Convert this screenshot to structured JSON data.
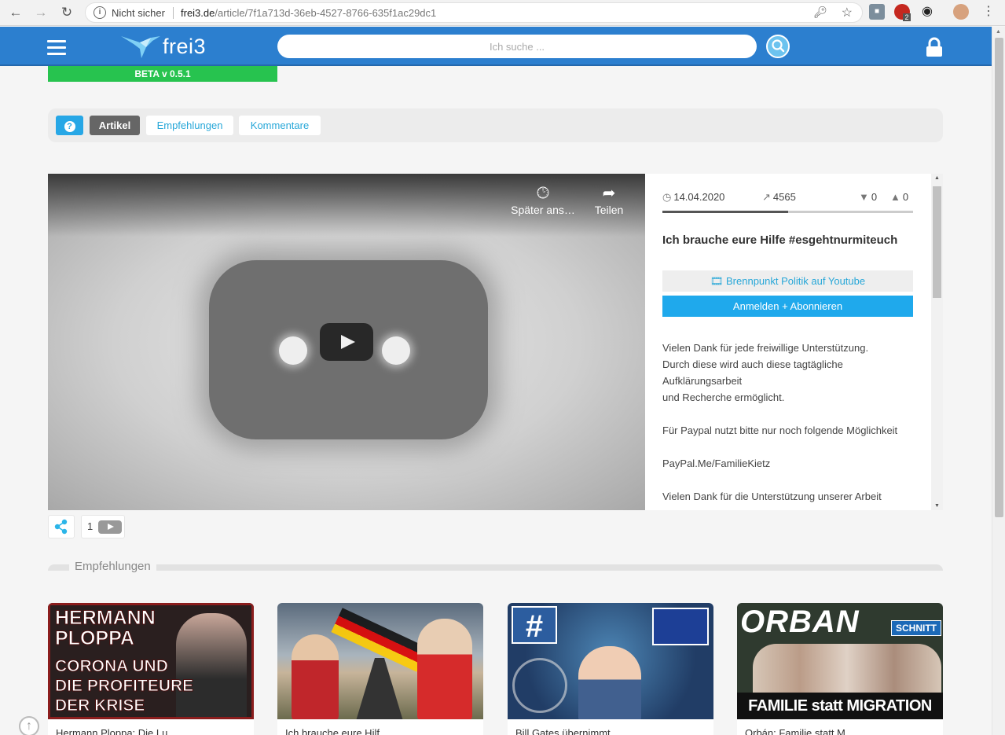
{
  "browser": {
    "security_label": "Nicht sicher",
    "url_domain": "frei3.de",
    "url_path": "/article/7f1a713d-36eb-4527-8766-635f1ac29dc1",
    "ext_badge": "2"
  },
  "header": {
    "logo_text": "frei3",
    "search_placeholder": "Ich suche ...",
    "beta_label": "BETA v 0.5.1"
  },
  "tabs": {
    "help_glyph": "?",
    "artikel": "Artikel",
    "empfehlungen": "Empfehlungen",
    "kommentare": "Kommentare"
  },
  "video": {
    "watch_later": "Später ans…",
    "share": "Teilen"
  },
  "article": {
    "date": "14.04.2020",
    "views": "4565",
    "dislikes": "0",
    "likes": "0",
    "title": "Ich brauche eure Hilfe #esgehtnurmiteuch",
    "channel_button": "Brennpunkt Politik auf Youtube",
    "subscribe_button": "Anmelden + Abonnieren",
    "description": "Vielen Dank für jede freiwillige Unterstützung.\nDurch diese wird auch diese tagtägliche Aufklärungsarbeit\nund Recherche ermöglicht.\n\nFür Paypal nutzt bitte nur noch folgende Möglichkeit\n\nPayPal.Me/FamilieKietz\n\nVielen Dank für die Unterstützung unserer Arbeit"
  },
  "share_row": {
    "count": "1"
  },
  "recommendations": {
    "section_title": "Empfehlungen",
    "cards": [
      {
        "thumb_lines": [
          "HERMANN",
          "PLOPPA",
          "CORONA UND",
          "DIE PROFITEURE",
          "DER KRISE"
        ],
        "caption": "Hermann Ploppa: Die Lu..."
      },
      {
        "caption": "Ich brauche eure Hilf..."
      },
      {
        "caption": "Bill Gates übernimmt..."
      },
      {
        "thumb_title": "ORBAN",
        "thumb_badge": "SCHNITT",
        "thumb_footer": "FAMILIE statt MIGRATION",
        "caption": "Orbán: Familie statt M..."
      }
    ]
  },
  "colors": {
    "header_blue": "#2c7fcf",
    "accent_cyan": "#1fa9ec",
    "beta_green": "#27c34f"
  }
}
